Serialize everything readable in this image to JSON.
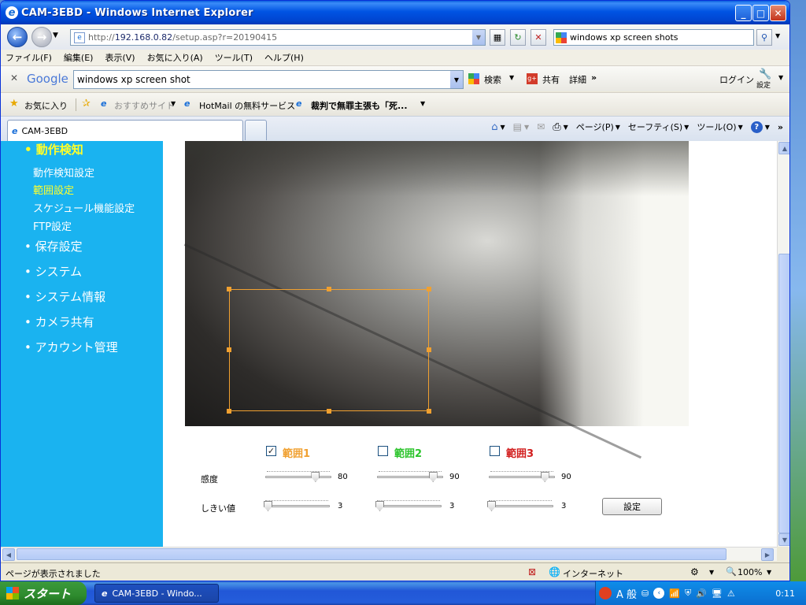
{
  "window": {
    "title": "CAM-3EBD - Windows Internet Explorer"
  },
  "address": {
    "url_prefix": "http://",
    "url_host": "192.168.0.82",
    "url_path": "/setup.asp?r=20190415",
    "search_text": "windows xp screen shots"
  },
  "menubar": [
    "ファイル(F)",
    "編集(E)",
    "表示(V)",
    "お気に入り(A)",
    "ツール(T)",
    "ヘルプ(H)"
  ],
  "google": {
    "logo": "Google",
    "query": "windows xp screen shot",
    "search_label": "検索",
    "share": "共有",
    "more": "詳細",
    "more_arrows": "»",
    "login": "ログイン",
    "settings": "設定"
  },
  "favorites": {
    "label": "お気に入り",
    "items": [
      "おすすめサイト",
      "HotMail の無料サービス",
      "裁判で無罪主張も「死..."
    ]
  },
  "tabs": {
    "active": "CAM-3EBD"
  },
  "commands": {
    "page": "ページ(P)",
    "safety": "セーフティ(S)",
    "tools": "ツール(O)"
  },
  "sidebar": {
    "motion": "• 動作検知",
    "sub1": "動作検知設定",
    "sub2": "範囲設定",
    "sub3": "スケジュール機能設定",
    "sub4": "FTP設定",
    "storage": "• 保存設定",
    "system": "• システム",
    "sysinfo": "• システム情報",
    "camshare": "• カメラ共有",
    "account": "• アカウント管理"
  },
  "zones": [
    {
      "label": "範囲1",
      "checked": true,
      "color": "#f0a030",
      "sensitivity": 80,
      "threshold": 3
    },
    {
      "label": "範囲2",
      "checked": false,
      "color": "#2cc42c",
      "sensitivity": 90,
      "threshold": 3
    },
    {
      "label": "範囲3",
      "checked": false,
      "color": "#d21e1e",
      "sensitivity": 90,
      "threshold": 3
    }
  ],
  "labels": {
    "sensitivity": "感度",
    "threshold": "しきい値",
    "set_button": "設定"
  },
  "status": {
    "text": "ページが表示されました",
    "zone": "インターネット",
    "zoom": "100%"
  },
  "taskbar": {
    "start": "スタート",
    "task": "CAM-3EBD - Windo...",
    "ime": "A 般",
    "clock": "0:11"
  }
}
